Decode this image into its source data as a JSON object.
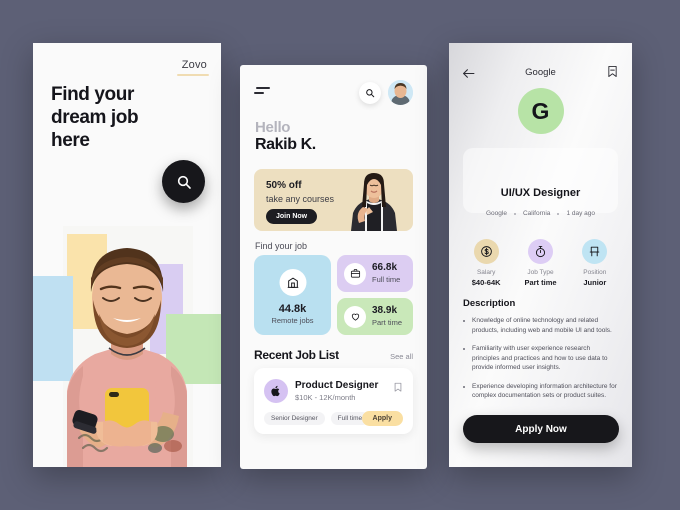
{
  "canvas": {
    "background": "#5d6076"
  },
  "screen_left": {
    "logo": "Zovo",
    "headline": "Find your\ndream job\nhere",
    "search_icon": "search-icon",
    "palette": {
      "yellow": "#fae3ab",
      "blue": "#bfe0f2",
      "purple": "#d9cdf2",
      "green": "#c4e7b6",
      "shirt": "#e8a9a0",
      "phone": "#f2c63c"
    }
  },
  "screen_home": {
    "menu_icon": "menu-icon",
    "search_icon": "search-icon",
    "avatar": "user-avatar",
    "greeting": "Hello",
    "user_name": "Rakib K.",
    "promo": {
      "title": "50% off",
      "subtitle": "take any courses",
      "button": "Join Now",
      "background": "#eddfc0"
    },
    "find_job_label": "Find your job",
    "stats": [
      {
        "value": "44.8k",
        "label": "Remote jobs",
        "icon": "building-icon",
        "color": "#b9e0f0"
      },
      {
        "value": "66.8k",
        "label": "Full time",
        "icon": "briefcase-icon",
        "color": "#dccdf2"
      },
      {
        "value": "38.9k",
        "label": "Part time",
        "icon": "heart-icon",
        "color": "#c9e8b9"
      }
    ],
    "recent_title": "Recent Job List",
    "see_all": "See all",
    "job_card": {
      "logo_icon": "apple-icon",
      "title": "Product Designer",
      "pay": "$10K - 12K/month",
      "bookmark_icon": "bookmark-icon",
      "tags": [
        "Senior Designer",
        "Full time"
      ],
      "apply_label": "Apply"
    }
  },
  "screen_detail": {
    "back_icon": "arrow-left-icon",
    "title": "Google",
    "bookmark_icon": "bookmark-icon",
    "company_initial": "G",
    "job_title": "UI/UX Designer",
    "meta": [
      "Google",
      "California",
      "1 day ago"
    ],
    "stats": [
      {
        "key": "Salary",
        "value": "$40-64K",
        "icon": "dollar-icon"
      },
      {
        "key": "Job Type",
        "value": "Part time",
        "icon": "stopwatch-icon"
      },
      {
        "key": "Position",
        "value": "Junior",
        "icon": "chair-icon"
      }
    ],
    "description_title": "Description",
    "bullets": [
      "Knowledge of online technology and related products, including web and mobile UI and tools.",
      "Familiarity with user experience research principles and practices and how to use data to provide informed user insights.",
      "Experience developing information architecture for complex documentation sets or product suites."
    ],
    "apply_label": "Apply Now"
  }
}
